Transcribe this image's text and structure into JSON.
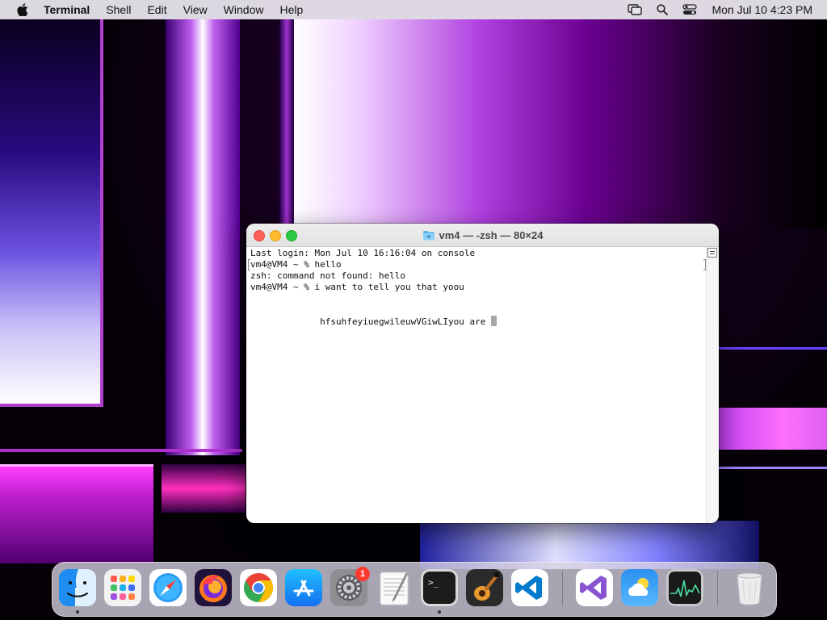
{
  "menubar": {
    "app_name": "Terminal",
    "menus": [
      "Shell",
      "Edit",
      "View",
      "Window",
      "Help"
    ],
    "clock": "Mon Jul 10  4:23 PM",
    "icons": [
      "screen-mirroring-icon",
      "search-icon",
      "control-center-icon"
    ]
  },
  "terminal": {
    "title": "vm4 — -zsh — 80×24",
    "folder_icon": "folder-icon",
    "lines": [
      "Last login: Mon Jul 10 16:16:04 on console",
      "vm4@VM4 ~ % hello",
      "zsh: command not found: hello",
      "vm4@VM4 ~ % i want to tell you that yoou",
      "",
      "",
      "             hfsuhfeyiuegwileuwVGiwLIyou are "
    ]
  },
  "dock": {
    "apps": [
      {
        "name": "Finder",
        "icon": "finder-icon",
        "running": true
      },
      {
        "name": "Launchpad",
        "icon": "launchpad-icon",
        "running": false
      },
      {
        "name": "Safari",
        "icon": "safari-icon",
        "running": false
      },
      {
        "name": "Firefox",
        "icon": "firefox-icon",
        "running": false
      },
      {
        "name": "Google Chrome",
        "icon": "chrome-icon",
        "running": false
      },
      {
        "name": "App Store",
        "icon": "app-store-icon",
        "running": false
      },
      {
        "name": "System Settings",
        "icon": "system-settings-icon",
        "running": false,
        "badge": "1"
      },
      {
        "name": "TextEdit",
        "icon": "textedit-icon",
        "running": false
      },
      {
        "name": "Terminal",
        "icon": "terminal-icon",
        "running": true
      },
      {
        "name": "GarageBand",
        "icon": "garageband-icon",
        "running": false
      },
      {
        "name": "Visual Studio Code",
        "icon": "vscode-icon",
        "running": false
      },
      {
        "name": "Visual Studio",
        "icon": "visual-studio-icon",
        "running": false
      },
      {
        "name": "Weather",
        "icon": "weather-icon",
        "running": false
      },
      {
        "name": "Activity Monitor",
        "icon": "activity-monitor-icon",
        "running": false
      },
      {
        "name": "Trash",
        "icon": "trash-icon",
        "running": false
      }
    ]
  }
}
